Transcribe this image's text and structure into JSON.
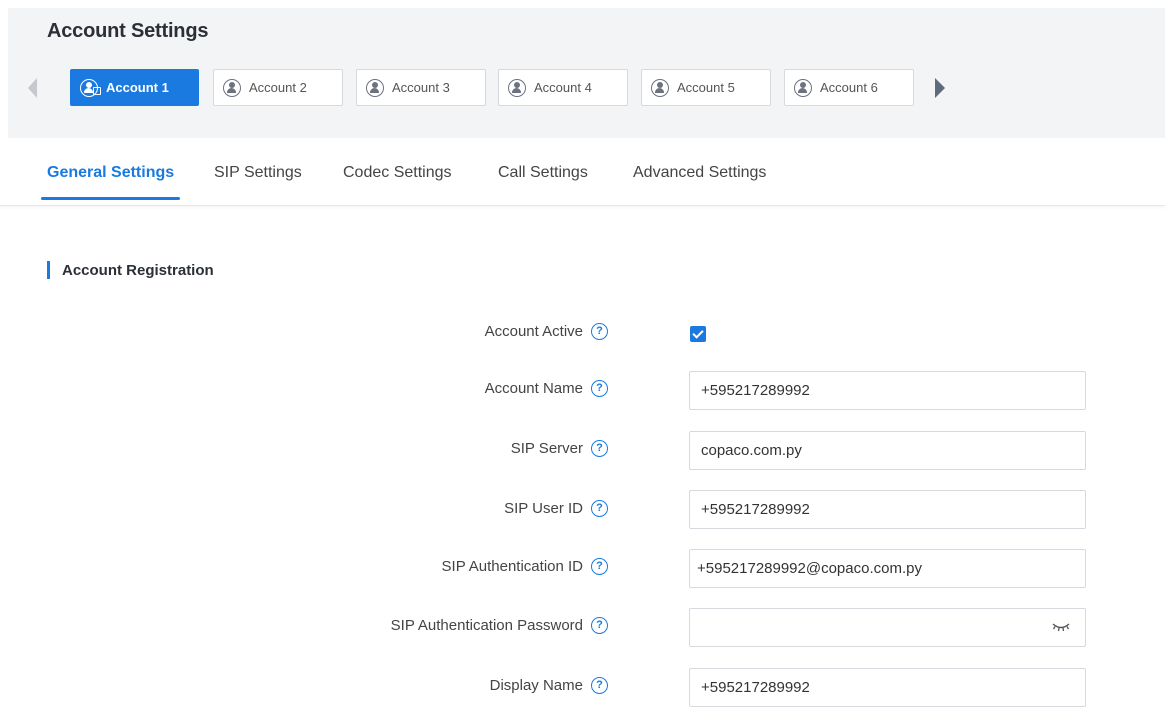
{
  "header": {
    "title": "Account Settings"
  },
  "accounts": [
    {
      "label": "Account 1",
      "active": true
    },
    {
      "label": "Account 2",
      "active": false
    },
    {
      "label": "Account 3",
      "active": false
    },
    {
      "label": "Account 4",
      "active": false
    },
    {
      "label": "Account 5",
      "active": false
    },
    {
      "label": "Account 6",
      "active": false
    }
  ],
  "tabs": [
    {
      "label": "General Settings",
      "active": true
    },
    {
      "label": "SIP Settings",
      "active": false
    },
    {
      "label": "Codec Settings",
      "active": false
    },
    {
      "label": "Call Settings",
      "active": false
    },
    {
      "label": "Advanced Settings",
      "active": false
    }
  ],
  "section": {
    "title": "Account Registration"
  },
  "form": {
    "account_active": {
      "label": "Account Active",
      "checked": true
    },
    "account_name": {
      "label": "Account Name",
      "value": "+595217289992"
    },
    "sip_server": {
      "label": "SIP Server",
      "value": "copaco.com.py"
    },
    "sip_user_id": {
      "label": "SIP User ID",
      "value": "+595217289992"
    },
    "sip_auth_id": {
      "label": "SIP Authentication ID",
      "value": "+595217289992@copaco.com.py"
    },
    "sip_auth_password": {
      "label": "SIP Authentication Password",
      "value": ""
    },
    "display_name": {
      "label": "Display Name",
      "value": "+595217289992"
    }
  },
  "help_glyph": "?",
  "colors": {
    "accent": "#1a7ae0",
    "header_bg": "#f3f4f6"
  }
}
